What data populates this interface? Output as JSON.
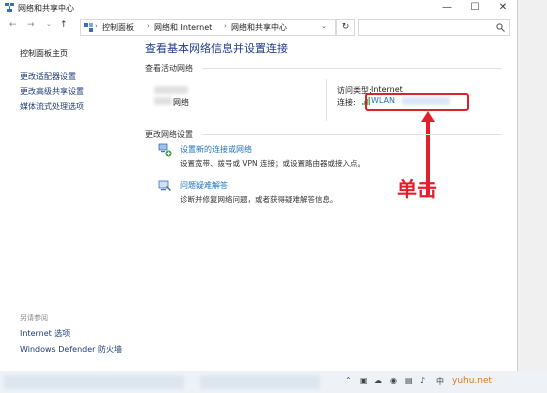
{
  "window": {
    "title": "网络和共享中心",
    "controls": {
      "minimize": "—",
      "maximize": "☐",
      "close": "✕"
    }
  },
  "address_bar": {
    "nav": {
      "back": "←",
      "forward": "→",
      "recent": "⌄",
      "up": "↑"
    },
    "breadcrumbs": [
      "控制面板",
      "网络和 Internet",
      "网络和共享中心"
    ],
    "separator": "›",
    "dropdown": "⌄",
    "refresh": "↻",
    "search_icon": "search-icon"
  },
  "sidebar": {
    "links": [
      "控制面板主页",
      "更改适配器设置",
      "更改高级共享设置",
      "媒体流式处理选项"
    ],
    "see_also_heading": "另请参阅",
    "see_also": [
      "Internet 选项",
      "Windows Defender 防火墙"
    ]
  },
  "main": {
    "heading": "查看基本网络信息并设置连接",
    "active_networks": {
      "heading": "查看活动网络",
      "network_name": "网络",
      "access_type_label": "访问类型:",
      "access_type_value": "Internet",
      "connection_label": "连接:",
      "connection_value": "WLAN"
    },
    "change_settings": {
      "heading": "更改网络设置",
      "tasks": [
        {
          "link": "设置新的连接或网络",
          "desc": "设置宽带、拨号或 VPN 连接；或设置路由器或接入点。",
          "icon": "network-setup-icon"
        },
        {
          "link": "问题疑难解答",
          "desc": "诊断并修复网络问题，或者获得疑难解答信息。",
          "icon": "troubleshoot-icon"
        }
      ]
    }
  },
  "annotation": {
    "text": "单击",
    "color": "#e0202c"
  },
  "taskbar": {
    "watermark": "yuhu.net"
  },
  "colors": {
    "link": "#1e73be",
    "heading": "#1e3a8a",
    "annotation": "#e0202c"
  }
}
